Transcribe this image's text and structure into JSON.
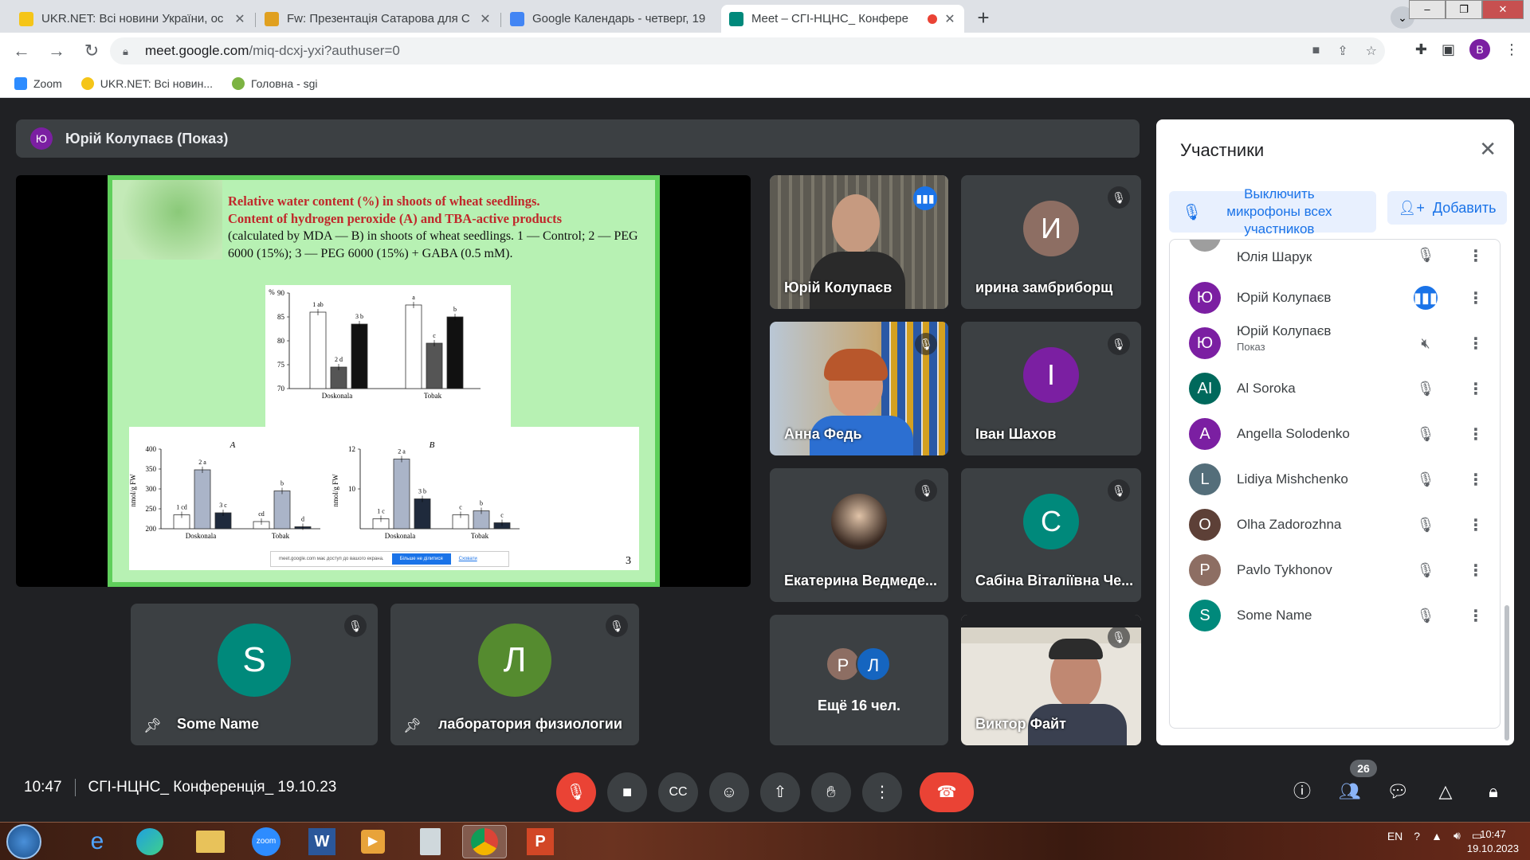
{
  "browser": {
    "tabs": [
      {
        "title": "UKR.NET: Всі новини України, ос",
        "color": "#f5c518"
      },
      {
        "title": "Fw: Презентація Сатарова для С",
        "color": "#e0a020"
      },
      {
        "title": "Google Календарь - четверг, 19",
        "color": "#4285f4"
      },
      {
        "title": "Meet – СГІ-НЦНС_ Конфере",
        "color": "#00897b"
      }
    ],
    "new_tab": "+",
    "url_host": "meet.google.com",
    "url_path": "/miq-dcxj-yxi?authuser=0",
    "profile_initial": "B",
    "bookmarks": [
      "Zoom",
      "UKR.NET: Всі новин...",
      "Головна - sgi"
    ]
  },
  "presenter_bar": {
    "initial": "Ю",
    "label": "Юрій Колупаєв (Показ)"
  },
  "slide": {
    "title_lines": [
      "Relative water content (%) in shoots of wheat seedlings.",
      "Content of hydrogen peroxide (A) and TBA-active products"
    ],
    "subtitle": "(calculated by MDA — B) in shoots of wheat seedlings. 1 — Control; 2 — PEG 6000 (15%); 3 — PEG 6000 (15%) + GABA (0.5 mM).",
    "slide_number": "3",
    "share_notice": "meet.google.com має доступ до вашого екрана.",
    "share_stop": "Більше не ділитися",
    "share_hide": "Сховати"
  },
  "chart_data": [
    {
      "type": "bar",
      "title": "",
      "ylabel": "%",
      "ylim": [
        70,
        90
      ],
      "yticks": [
        70,
        75,
        80,
        85,
        90
      ],
      "categories": [
        "Doskonala",
        "Tobak"
      ],
      "series": [
        {
          "values": [
            86,
            87.5
          ],
          "color": "#ffffff",
          "labels": [
            "1 ab",
            "a"
          ]
        },
        {
          "values": [
            74.5,
            79.5
          ],
          "color": "#555555",
          "labels": [
            "2 d",
            "c"
          ]
        },
        {
          "values": [
            83.5,
            85
          ],
          "color": "#111111",
          "labels": [
            "3 b",
            "b"
          ]
        }
      ]
    },
    {
      "type": "bar",
      "title": "A",
      "ylabel": "nmol/g FW",
      "ylim": [
        200,
        400
      ],
      "yticks": [
        200,
        250,
        300,
        350,
        400
      ],
      "categories": [
        "Doskonala",
        "Tobak"
      ],
      "series": [
        {
          "values": [
            235,
            218
          ],
          "color": "#ffffff",
          "labels": [
            "1 cd",
            "cd"
          ]
        },
        {
          "values": [
            348,
            295
          ],
          "color": "#aab4c8",
          "labels": [
            "2 a",
            "b"
          ]
        },
        {
          "values": [
            240,
            205
          ],
          "color": "#1f2a3c",
          "labels": [
            "3 c",
            "d"
          ]
        }
      ]
    },
    {
      "type": "bar",
      "title": "B",
      "ylabel": "nmol/g FW",
      "ylim": [
        8,
        12
      ],
      "yticks": [
        10,
        12
      ],
      "categories": [
        "Doskonala",
        "Tobak"
      ],
      "series": [
        {
          "values": [
            8.5,
            8.7
          ],
          "color": "#ffffff",
          "labels": [
            "1 c",
            "c"
          ]
        },
        {
          "values": [
            11.5,
            8.9
          ],
          "color": "#aab4c8",
          "labels": [
            "2 a",
            "b"
          ]
        },
        {
          "values": [
            9.5,
            8.3
          ],
          "color": "#1f2a3c",
          "labels": [
            "3 b",
            "c"
          ]
        }
      ]
    }
  ],
  "tiles": [
    {
      "name": "Юрій Колупаєв",
      "type": "video",
      "speaking": true
    },
    {
      "name": "ирина замбриборщ",
      "initial": "И",
      "color": "#8d6e63"
    },
    {
      "name": "Анна Федь",
      "type": "video"
    },
    {
      "name": "Іван Шахов",
      "initial": "І",
      "color": "#7b1fa2"
    },
    {
      "name": "Екатерина Ведмеде...",
      "type": "avatar-photo"
    },
    {
      "name": "Сабіна Віталіївна Че...",
      "initial": "С",
      "color": "#00897b"
    },
    {
      "name": "Ещё 16 чел.",
      "avatars": [
        "Р",
        "Л"
      ],
      "colors": [
        "#8d6e63",
        "#1565c0"
      ]
    },
    {
      "name": "Виктор Файт",
      "type": "video"
    },
    {
      "name": "Some Name",
      "initial": "S",
      "color": "#00897b"
    },
    {
      "name": "лаборатория физиологии",
      "initial": "Л",
      "color": "#558b2f"
    }
  ],
  "participants_panel": {
    "title": "Участники",
    "mute_all": "Выключить микрофоны всех участников",
    "add": "Добавить",
    "people": [
      {
        "name": "Юлія Шарук",
        "initial": "",
        "color": "#9e9e9e"
      },
      {
        "name": "Юрій Колупаєв",
        "initial": "Ю",
        "color": "#7b1fa2",
        "speaking": true
      },
      {
        "name": "Юрій Колупаєв",
        "sub": "Показ",
        "initial": "Ю",
        "color": "#7b1fa2"
      },
      {
        "name": "Al Soroka",
        "initial": "AI",
        "color": "#00695c"
      },
      {
        "name": "Angella Solodenko",
        "initial": "A",
        "color": "#7b1fa2"
      },
      {
        "name": "Lidiya Mishchenko",
        "initial": "L",
        "color": "#546e7a"
      },
      {
        "name": "Olha Zadorozhna",
        "initial": "O",
        "color": "#5d4037"
      },
      {
        "name": "Pavlo Tykhonov",
        "initial": "P",
        "color": "#8d6e63"
      },
      {
        "name": "Some Name",
        "initial": "S",
        "color": "#00897b"
      }
    ]
  },
  "bottom_bar": {
    "time": "10:47",
    "meeting_name": "СГІ-НЦНС_ Конференція_ 19.10.23",
    "participants_count": "26"
  },
  "taskbar": {
    "lang": "EN",
    "time": "10:47",
    "date": "19.10.2023"
  }
}
